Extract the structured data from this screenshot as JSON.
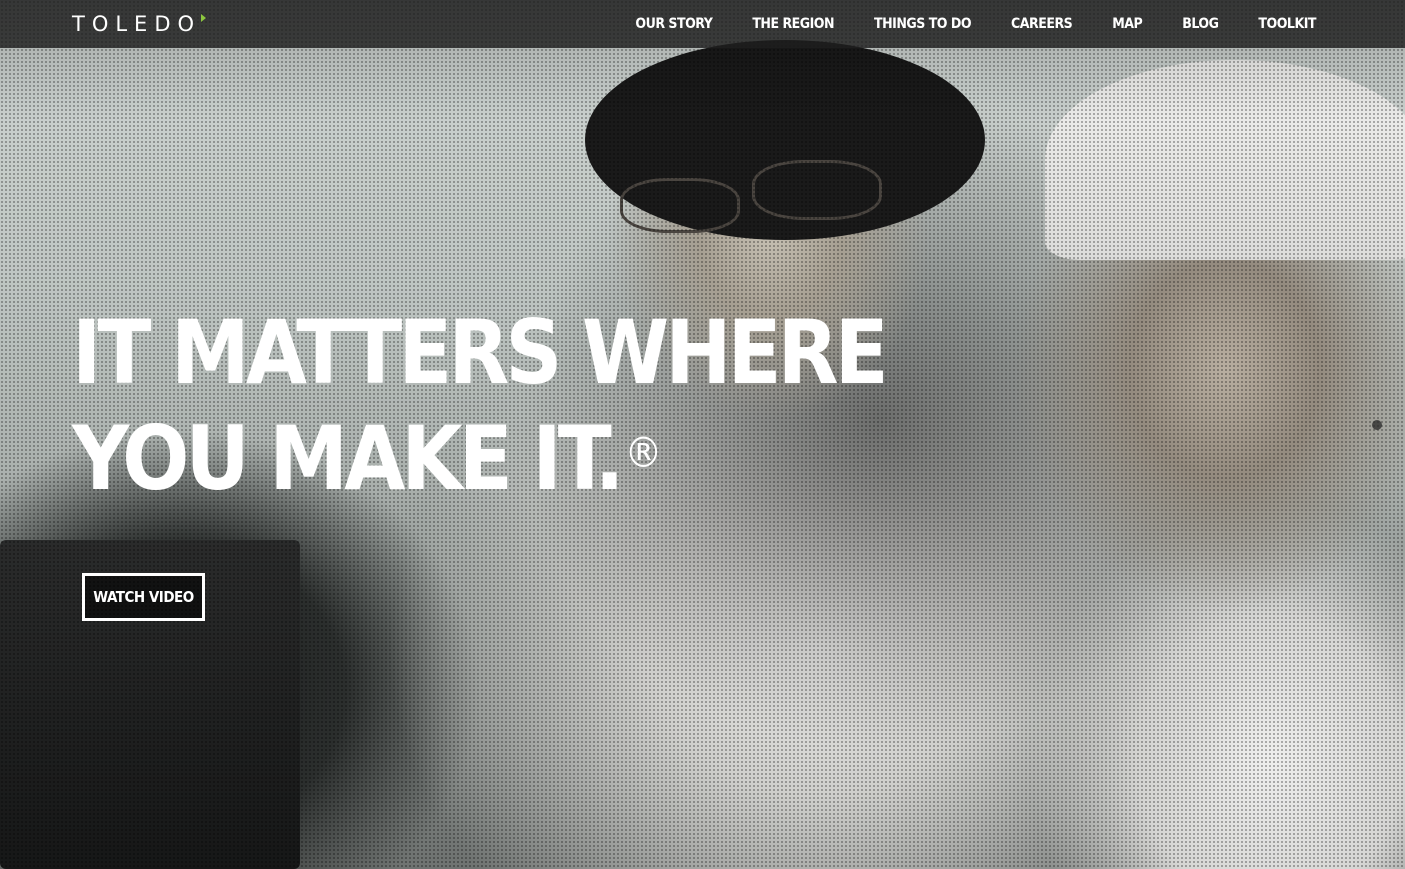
{
  "header": {
    "logo_text": "TOLEDO",
    "logo_accent_color": "#8cc63f",
    "nav": [
      {
        "label": "OUR STORY"
      },
      {
        "label": "THE REGION"
      },
      {
        "label": "THINGS TO DO"
      },
      {
        "label": "CAREERS"
      },
      {
        "label": "MAP"
      },
      {
        "label": "BLOG"
      },
      {
        "label": "TOOLKIT"
      }
    ]
  },
  "hero": {
    "headline_line1": "IT MATTERS WHERE",
    "headline_line2": "YOU MAKE IT.",
    "registered_mark": "®",
    "cta_label": "WATCH VIDEO"
  }
}
